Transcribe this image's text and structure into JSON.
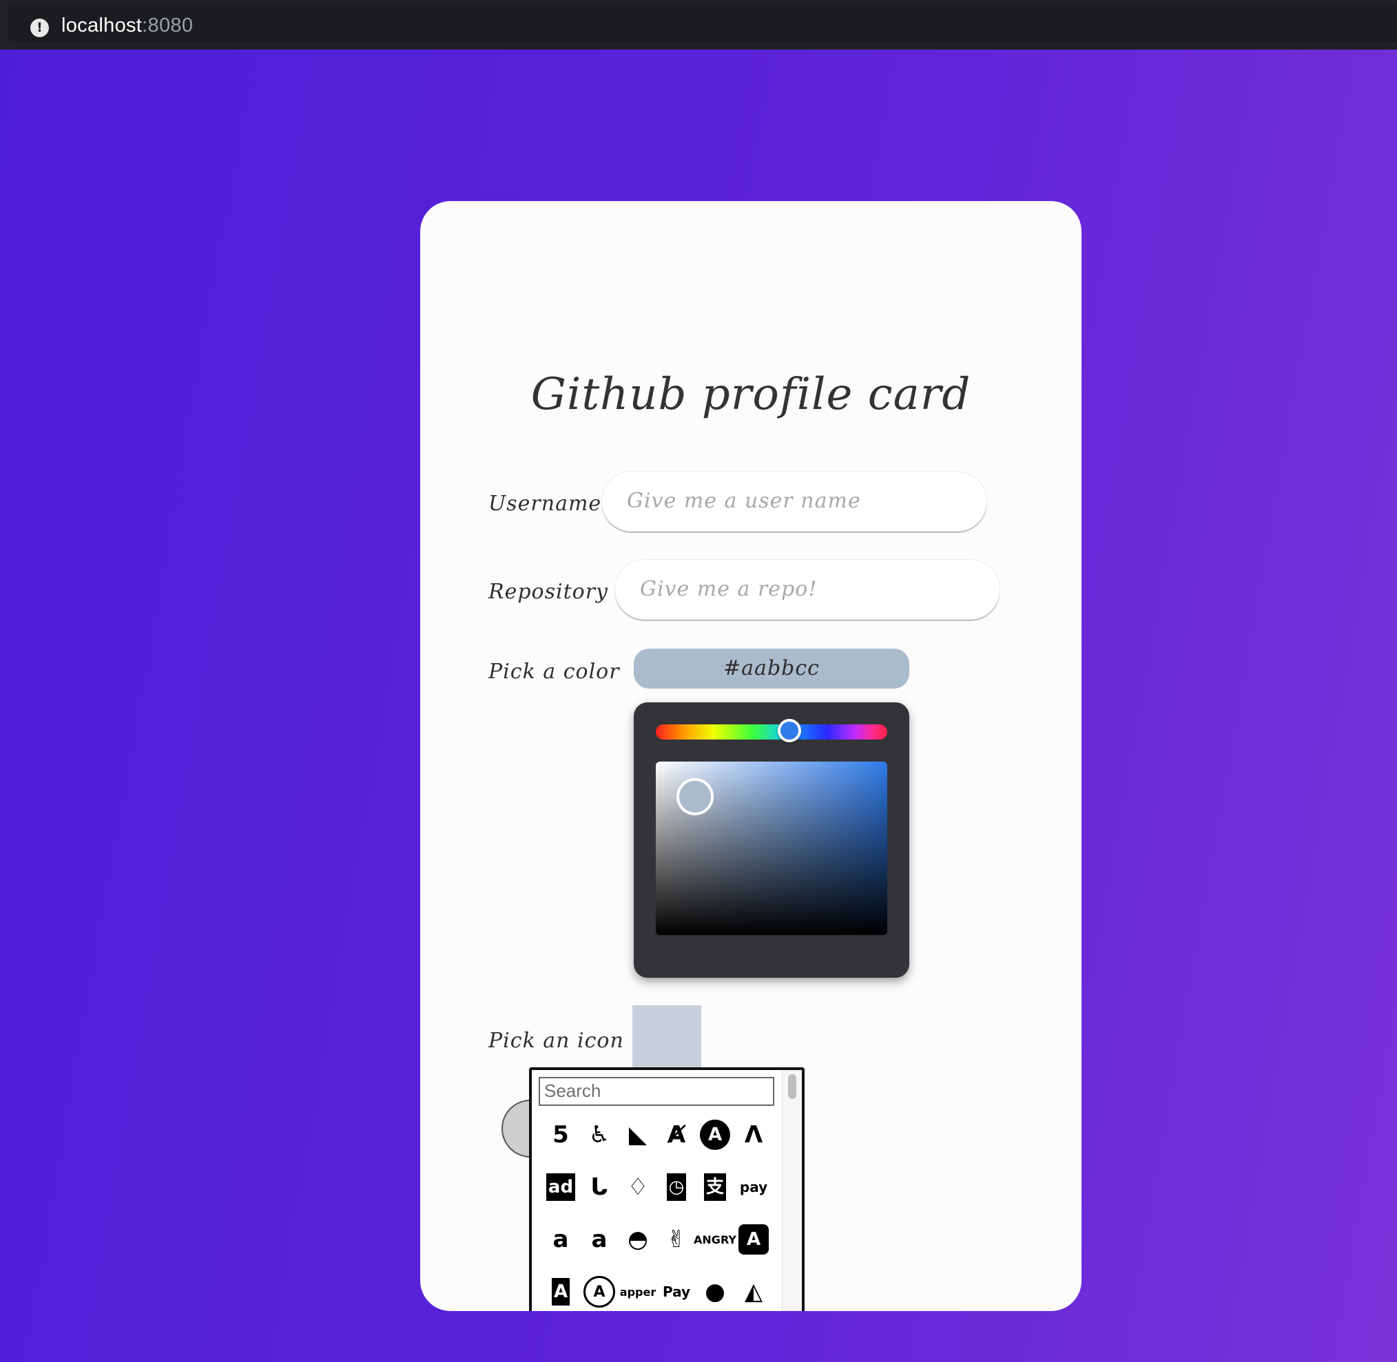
{
  "browser": {
    "host": "localhost",
    "port": ":8080"
  },
  "card": {
    "title": "Github profile card",
    "username": {
      "label": "Username",
      "placeholder": "Give me a user name"
    },
    "repository": {
      "label": "Repository",
      "placeholder": "Give me a repo!"
    },
    "color": {
      "label": "Pick a color",
      "value": "#aabbcc",
      "hue_fraction": 0.6
    },
    "icon": {
      "label": "Pick an icon",
      "search_placeholder": "Search",
      "icons": [
        "500px",
        "accessible-icon",
        "accusoft",
        "acquisitions-incorporated",
        "adn",
        "adobe",
        "adversal",
        "affiliatetheme",
        "airbnb",
        "algolia",
        "alipay",
        "amazon-pay",
        "amazon",
        "amilia",
        "android",
        "angellist",
        "angrycreative",
        "angular",
        "app-store-ios",
        "app-store",
        "apper",
        "apple-pay",
        "apple",
        "artstation"
      ]
    }
  }
}
